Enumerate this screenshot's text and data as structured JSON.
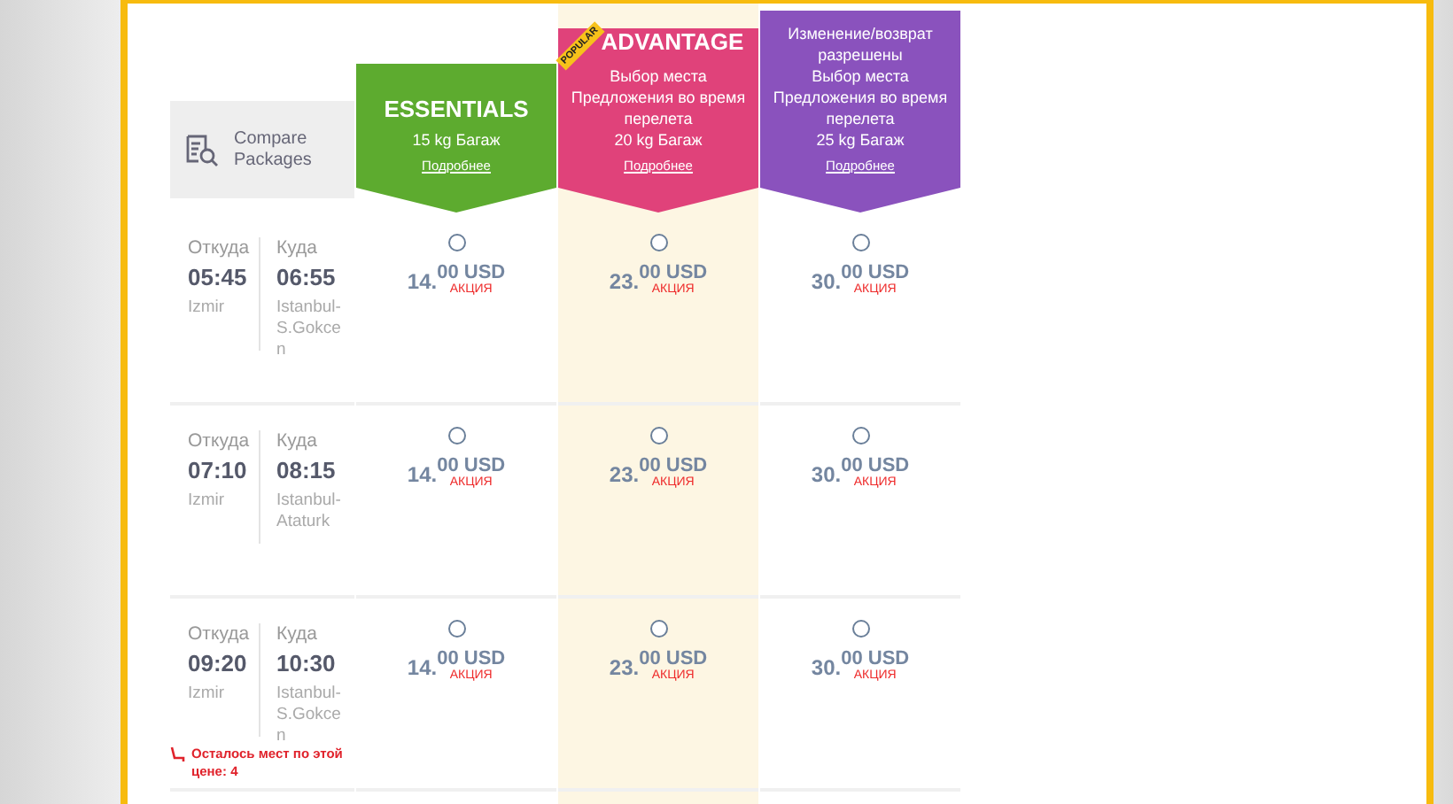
{
  "compare": {
    "label": "Compare Packages"
  },
  "packages": [
    {
      "name": "ESSENTIALS",
      "color": "#5dab2f",
      "features": [
        "15 kg Багаж"
      ],
      "link": "Подробнее",
      "highlighted": false
    },
    {
      "name": "ADVANTAGE",
      "color": "#e0427a",
      "features": [
        "Выбор места",
        "Предложения во время перелета",
        "20 kg Багаж"
      ],
      "link": "Подробнее",
      "popular_badge": "POPULAR",
      "highlighted": true
    },
    {
      "color": "#8a52bd",
      "features": [
        "Изменение/возврат разрешены",
        "Выбор места",
        "Предложения во время перелета",
        "25 kg Багаж"
      ],
      "link": "Подробнее",
      "highlighted": false
    }
  ],
  "flights": [
    {
      "from_label": "Откуда",
      "depart": "05:45",
      "from_city": "Izmir",
      "to_label": "Куда",
      "arrive": "06:55",
      "to_city": "Istanbul-S.Gokcen",
      "fares": [
        {
          "whole": "14.",
          "fraction": "00 USD",
          "tag": "АКЦИЯ",
          "selected": false
        },
        {
          "whole": "23.",
          "fraction": "00 USD",
          "tag": "АКЦИЯ",
          "selected": false
        },
        {
          "whole": "30.",
          "fraction": "00 USD",
          "tag": "АКЦИЯ",
          "selected": false
        }
      ]
    },
    {
      "from_label": "Откуда",
      "depart": "07:10",
      "from_city": "Izmir",
      "to_label": "Куда",
      "arrive": "08:15",
      "to_city": "Istanbul-Ataturk",
      "fares": [
        {
          "whole": "14.",
          "fraction": "00 USD",
          "tag": "АКЦИЯ",
          "selected": false
        },
        {
          "whole": "23.",
          "fraction": "00 USD",
          "tag": "АКЦИЯ",
          "selected": false
        },
        {
          "whole": "30.",
          "fraction": "00 USD",
          "tag": "АКЦИЯ",
          "selected": false
        }
      ]
    },
    {
      "from_label": "Откуда",
      "depart": "09:20",
      "from_city": "Izmir",
      "to_label": "Куда",
      "arrive": "10:30",
      "to_city": "Istanbul-S.Gokcen",
      "seats_left": "Осталось мест по этой цене: 4",
      "fares": [
        {
          "whole": "14.",
          "fraction": "00 USD",
          "tag": "АКЦИЯ",
          "selected": false
        },
        {
          "whole": "23.",
          "fraction": "00 USD",
          "tag": "АКЦИЯ",
          "selected": false
        },
        {
          "whole": "30.",
          "fraction": "00 USD",
          "tag": "АКЦИЯ",
          "selected": false
        }
      ]
    }
  ]
}
